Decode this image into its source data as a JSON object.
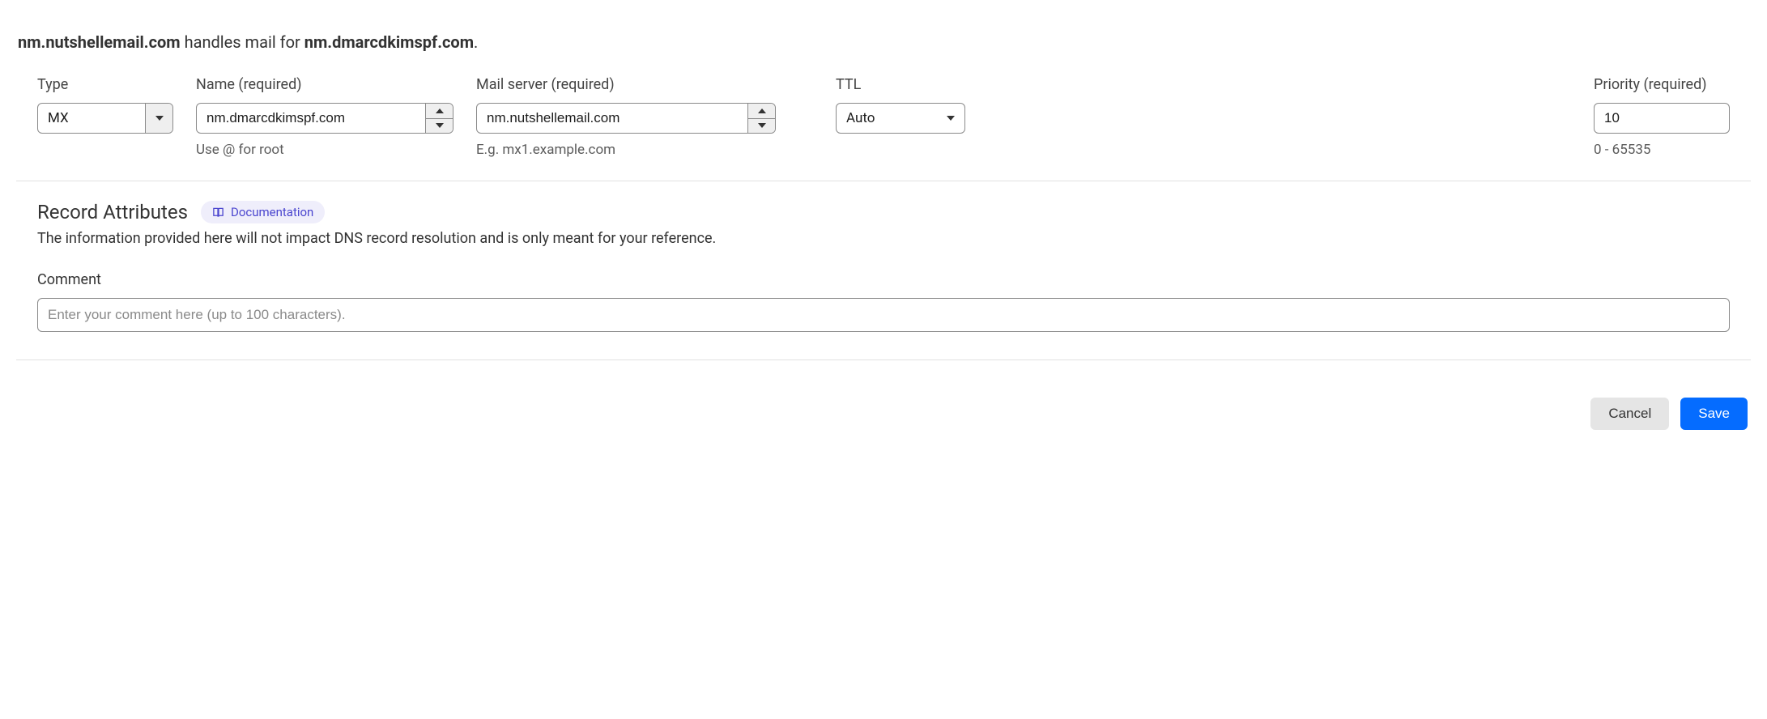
{
  "header": {
    "mail_server_host": "nm.nutshellemail.com",
    "mid_text": " handles mail for ",
    "domain_host": "nm.dmarcdkimspf.com",
    "trailing": "."
  },
  "fields": {
    "type": {
      "label": "Type",
      "value": "MX"
    },
    "name": {
      "label": "Name (required)",
      "value": "nm.dmarcdkimspf.com",
      "helper": "Use @ for root"
    },
    "mail": {
      "label": "Mail server (required)",
      "value": "nm.nutshellemail.com",
      "helper": "E.g. mx1.example.com"
    },
    "ttl": {
      "label": "TTL",
      "value": "Auto"
    },
    "priority": {
      "label": "Priority (required)",
      "value": "10",
      "helper": "0 - 65535"
    }
  },
  "attributes": {
    "title": "Record Attributes",
    "doc_label": "Documentation",
    "description": "The information provided here will not impact DNS record resolution and is only meant for your reference.",
    "comment_label": "Comment",
    "comment_placeholder": "Enter your comment here (up to 100 characters)."
  },
  "footer": {
    "cancel": "Cancel",
    "save": "Save"
  }
}
